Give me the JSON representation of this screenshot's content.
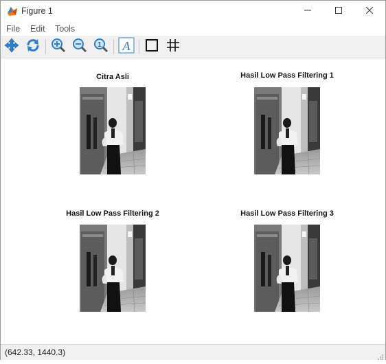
{
  "window": {
    "title": "Figure 1"
  },
  "menu": {
    "items": [
      "File",
      "Edit",
      "Tools"
    ]
  },
  "toolbar": {
    "buttons": [
      "pan-icon",
      "reset-icon",
      "zoom-in-icon",
      "zoom-out-icon",
      "zoom-fit-icon",
      "text-icon",
      "box-icon",
      "grid-icon"
    ]
  },
  "plots": [
    {
      "title": "Citra Asli"
    },
    {
      "title": "Hasil Low Pass Filtering 1"
    },
    {
      "title": "Hasil Low Pass Filtering 2"
    },
    {
      "title": "Hasil Low Pass Filtering 3"
    }
  ],
  "status": {
    "coords": "(642.33, 1440.3)"
  },
  "colors": {
    "toolbar_bg": "#f0f0f0",
    "icon_blue": "#2f7fd0",
    "icon_orange": "#f07a1a"
  }
}
